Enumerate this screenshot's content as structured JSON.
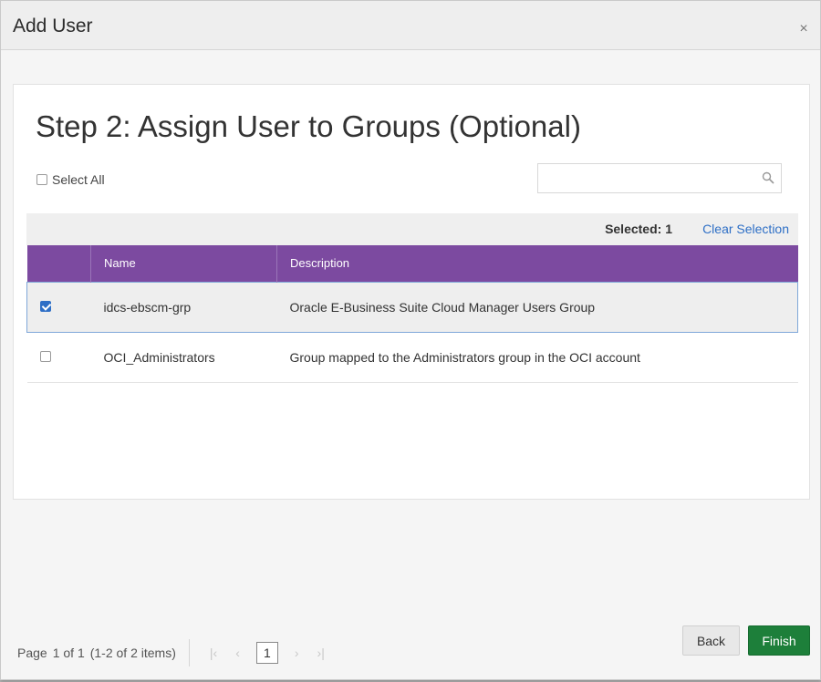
{
  "dialog": {
    "title": "Add User",
    "close_label": "×"
  },
  "step": {
    "title": "Step 2: Assign User to Groups (Optional)"
  },
  "select_all": {
    "label": "Select All",
    "checked": false
  },
  "search": {
    "value": "",
    "placeholder": ""
  },
  "selection": {
    "selected_label": "Selected: 1",
    "clear_label": "Clear Selection"
  },
  "table": {
    "columns": [
      "",
      "Name",
      "Description"
    ],
    "rows": [
      {
        "checked": true,
        "name": "idcs-ebscm-grp",
        "description": "Oracle E-Business Suite Cloud Manager Users Group"
      },
      {
        "checked": false,
        "name": "OCI_Administrators",
        "description": "Group mapped to the Administrators group in the OCI account"
      }
    ]
  },
  "pagination": {
    "page_label": "Page",
    "page_of": "1 of 1",
    "items_label": "(1-2 of 2 items)",
    "first": "|‹",
    "prev": "‹",
    "current": "1",
    "next": "›",
    "last": "›|"
  },
  "buttons": {
    "back": "Back",
    "finish": "Finish"
  },
  "colors": {
    "header_purple": "#7c4aa0",
    "link_blue": "#2e6fc6",
    "finish_green": "#1d7f3a"
  }
}
